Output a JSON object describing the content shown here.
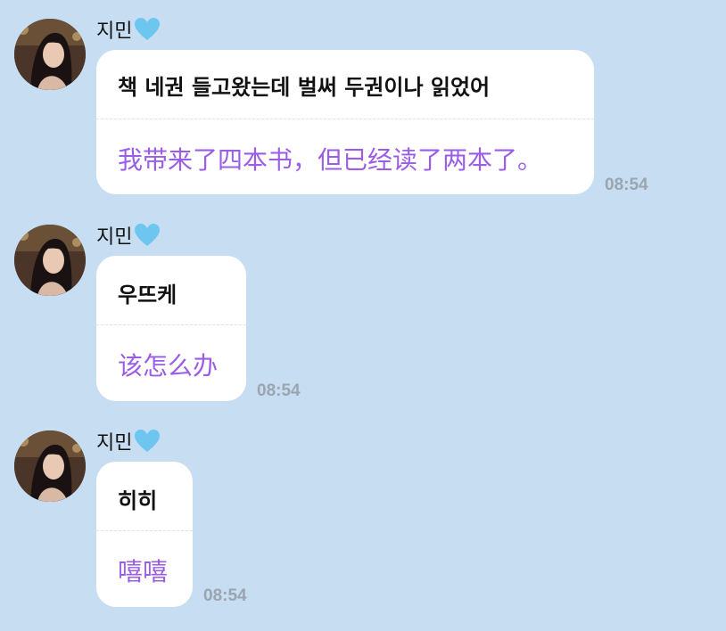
{
  "colors": {
    "background": "#c7ddf2",
    "bubble": "#ffffff",
    "translation_text": "#9b5de5",
    "timestamp": "#9aa5b1",
    "heart": "#6cc6f0"
  },
  "messages": [
    {
      "sender": "지민",
      "sender_badge_icon": "light-blue-heart-icon",
      "original": "책 네권 들고왔는데 벌써 두권이나 읽었어",
      "translation": "我带来了四本书，但已经读了两本了。",
      "time": "08:54"
    },
    {
      "sender": "지민",
      "sender_badge_icon": "light-blue-heart-icon",
      "original": "우뜨케",
      "translation": "该怎么办",
      "time": "08:54"
    },
    {
      "sender": "지민",
      "sender_badge_icon": "light-blue-heart-icon",
      "original": "히히",
      "translation": "嘻嘻",
      "time": "08:54"
    }
  ]
}
